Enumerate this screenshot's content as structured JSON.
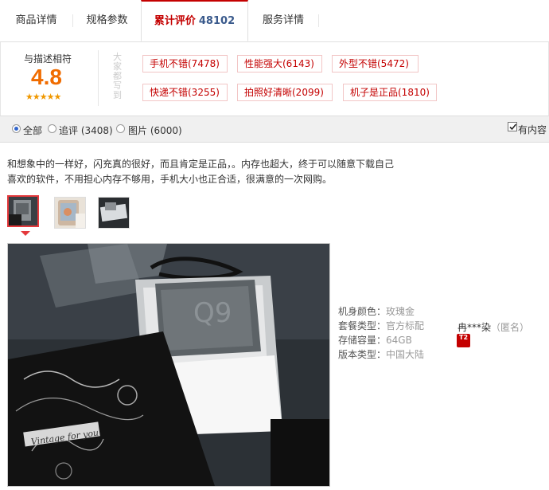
{
  "tabs": [
    {
      "label": "商品详情"
    },
    {
      "label": "规格参数"
    },
    {
      "label": "累计评价",
      "count": "48102"
    },
    {
      "label": "服务详情"
    }
  ],
  "summary": {
    "title": "与描述相符",
    "score": "4.8",
    "stars": "★★★★★",
    "vertical_label": "大家都写到"
  },
  "tags": [
    {
      "label": "手机不错(7478)"
    },
    {
      "label": "性能强大(6143)"
    },
    {
      "label": "外型不错(5472)"
    },
    {
      "label": "快递不错(3255)"
    },
    {
      "label": "拍照好清晰(2099)"
    },
    {
      "label": "机子是正品(1810)"
    }
  ],
  "filters": {
    "options": [
      {
        "label": "全部",
        "selected": true
      },
      {
        "label": "追评 (3408)",
        "selected": false
      },
      {
        "label": "图片 (6000)",
        "selected": false
      }
    ],
    "has_content_label": "有内容",
    "has_content_checked": true
  },
  "review": {
    "text_line1": "和想象中的一样好，闪充真的很好，而且肯定是正品，。内存也超大，终于可以随意下载自己",
    "text_line2": "喜欢的软件，不用担心内存不够用，手机大小也正合适，很满意的一次网购。",
    "image_count": 3,
    "selected_image": 0,
    "meta": [
      {
        "key": "机身颜色：",
        "value": "玫瑰金"
      },
      {
        "key": "套餐类型：",
        "value": "官方标配"
      },
      {
        "key": "存储容量：",
        "value": "64GB"
      },
      {
        "key": "版本类型：",
        "value": "中国大陆"
      }
    ],
    "user": {
      "name": "冉***染",
      "anon": "（匿名）",
      "badge": "T2"
    },
    "card_text": "Q9",
    "vintage_text": "Vintage for you"
  },
  "colors": {
    "accent": "#c40000",
    "score": "#f06c00",
    "star": "#f09800",
    "link": "#3a5a8c"
  }
}
